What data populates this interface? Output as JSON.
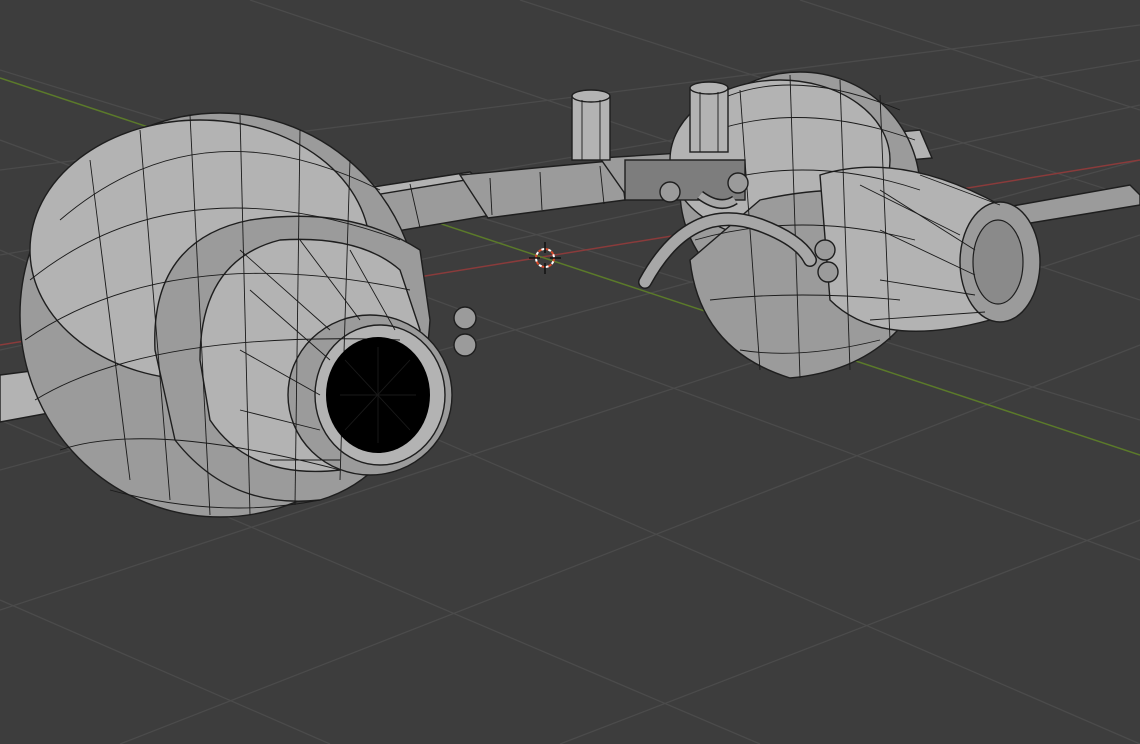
{
  "viewport": {
    "mode": "wireframe-overlay",
    "background": "#3d3d3d",
    "grid_color": "#4b4b4b",
    "x_axis_color": "#8a3b3b",
    "y_axis_color": "#5b7a2a",
    "cursor_color": "#d94a2a",
    "mesh_color": "#a7a7a7"
  },
  "objects": [
    {
      "name": "left-turbine-engine"
    },
    {
      "name": "right-turbine-engine"
    },
    {
      "name": "connecting-beam"
    },
    {
      "name": "center-mount-posts"
    },
    {
      "name": "curved-pipe"
    }
  ],
  "icons": {
    "cursor": "3d-cursor-icon"
  }
}
